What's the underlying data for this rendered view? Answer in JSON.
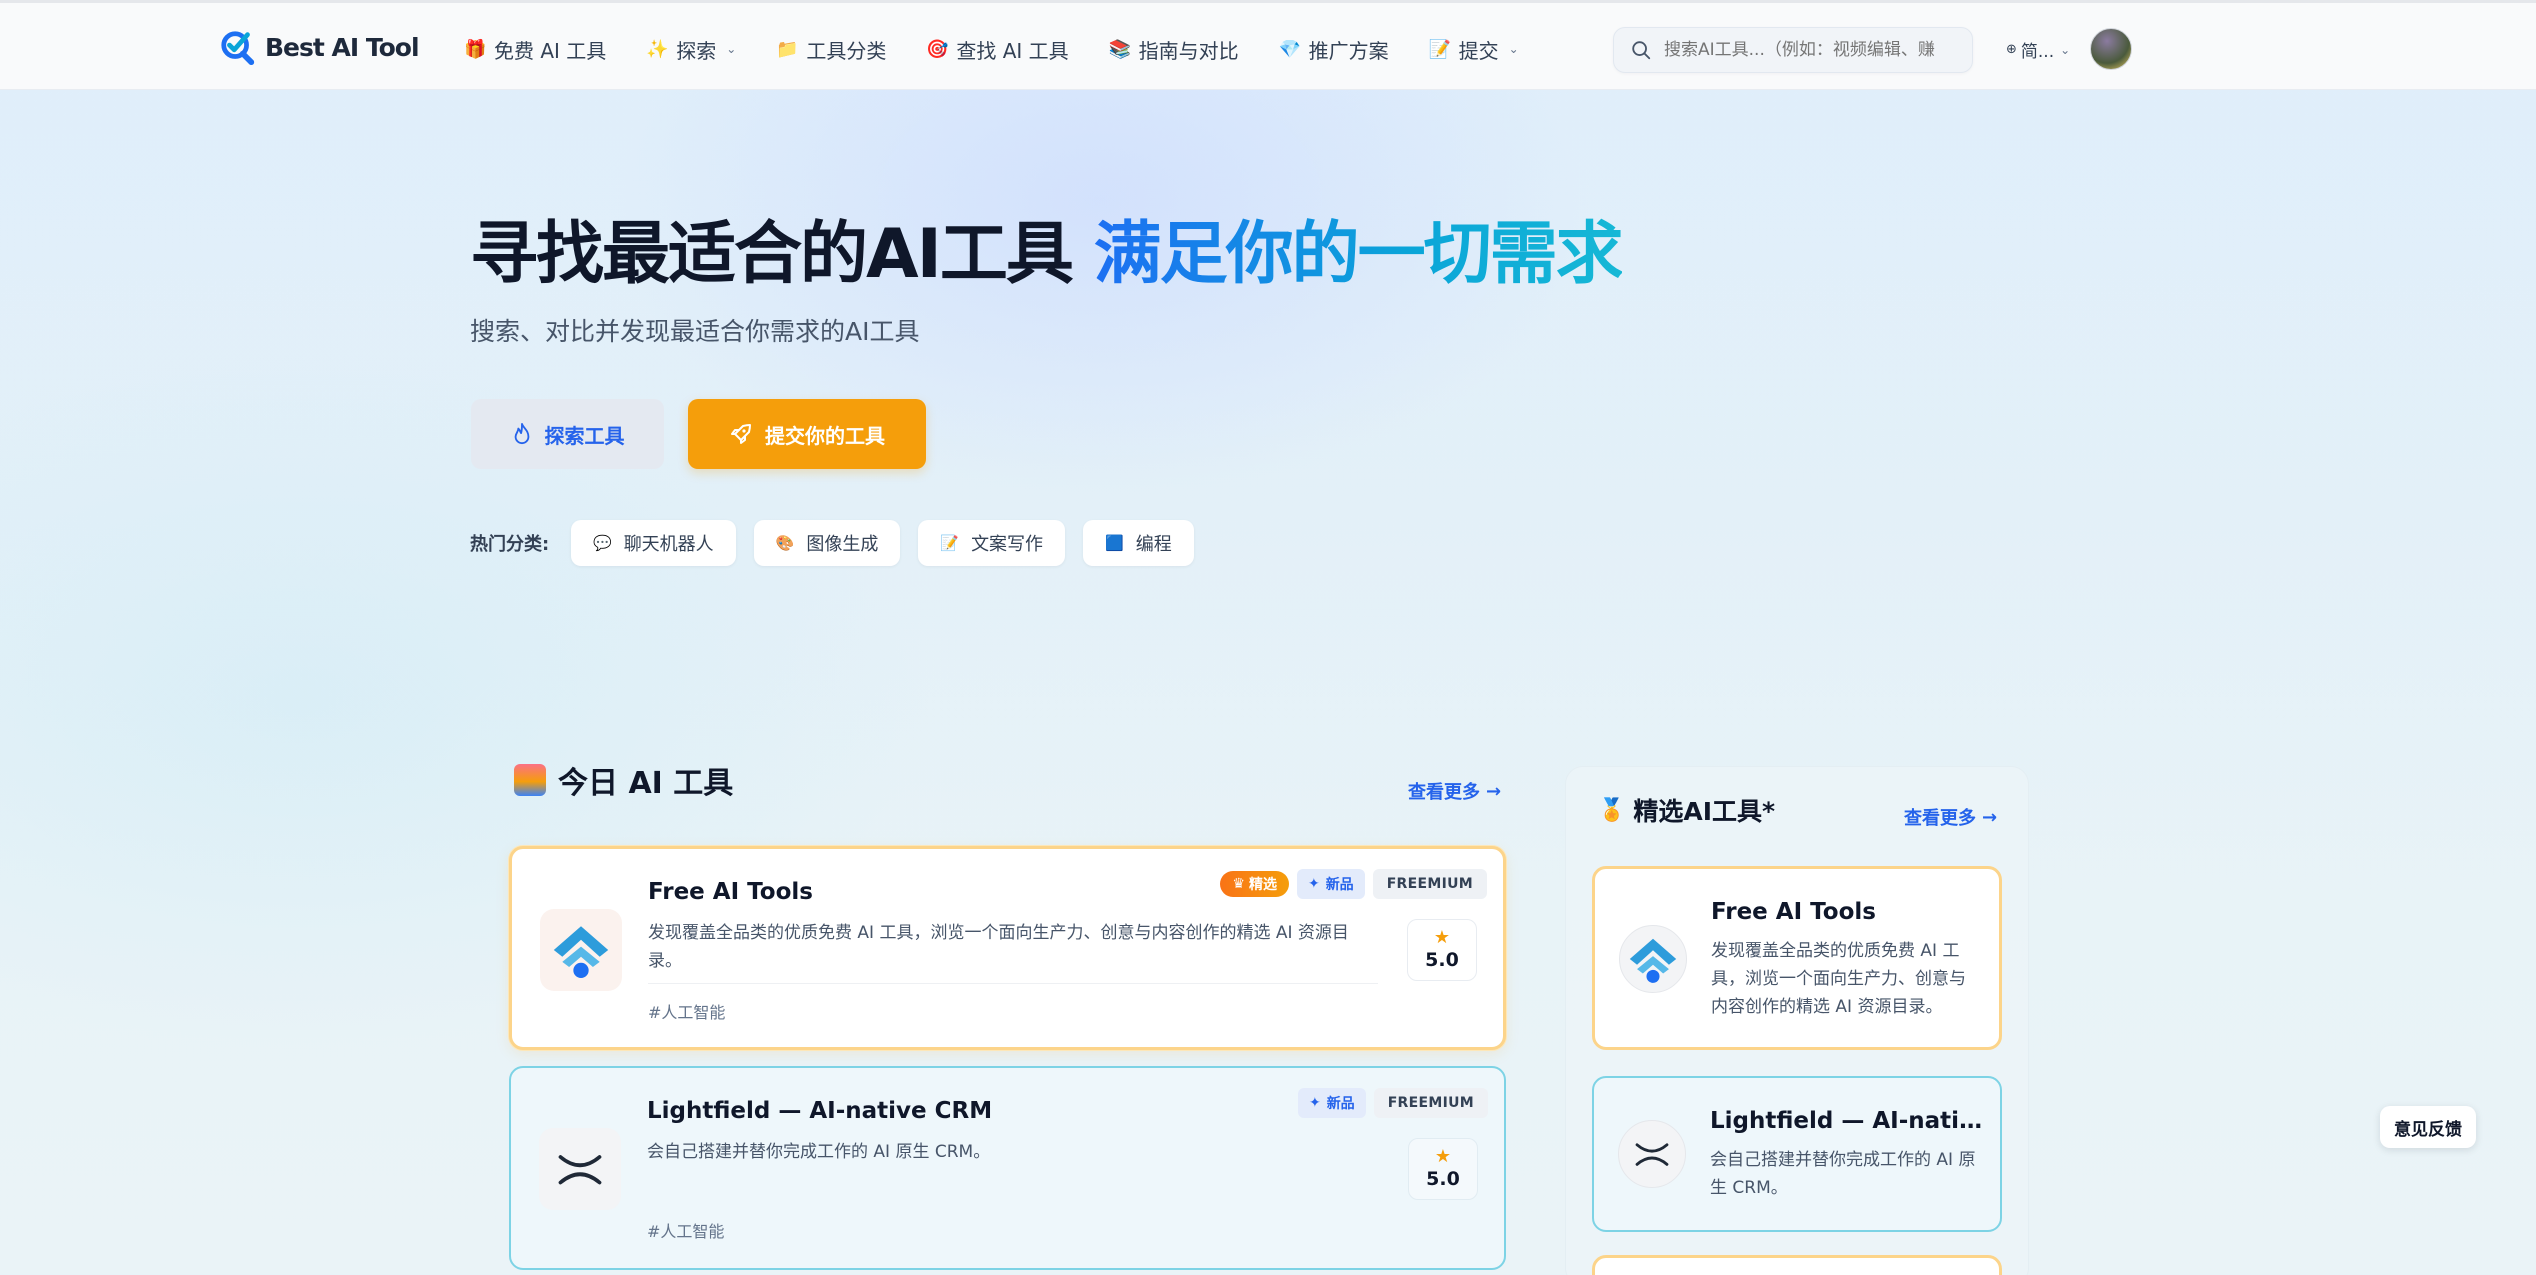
{
  "header": {
    "brand": "Best AI Tool",
    "nav": [
      {
        "icon": "gift-icon",
        "glyph": "🎁",
        "label": "免费 AI 工具",
        "dropdown": false
      },
      {
        "icon": "sparkle-icon",
        "glyph": "✨",
        "label": "探索",
        "dropdown": true
      },
      {
        "icon": "folder-icon",
        "glyph": "📁",
        "label": "工具分类",
        "dropdown": false
      },
      {
        "icon": "target-icon",
        "glyph": "🎯",
        "label": "查找 AI 工具",
        "dropdown": false
      },
      {
        "icon": "books-icon",
        "glyph": "📚",
        "label": "指南与对比",
        "dropdown": false
      },
      {
        "icon": "diamond-icon",
        "glyph": "💎",
        "label": "推广方案",
        "dropdown": false
      },
      {
        "icon": "memo-icon",
        "glyph": "📝",
        "label": "提交",
        "dropdown": true
      }
    ],
    "search_placeholder": "搜索AI工具...（例如：视频编辑、赚",
    "language": "简..."
  },
  "hero": {
    "title_dark": "寻找最适合的AI工具",
    "title_accent": "满足你的一切需求",
    "subtitle": "搜索、对比并发现最适合你需求的AI工具",
    "explore_button": "探索工具",
    "submit_button": "提交你的工具",
    "hot_label": "热门分类:",
    "hot_categories": [
      {
        "icon": "speech-bubble-icon",
        "glyph": "💬",
        "label": "聊天机器人"
      },
      {
        "icon": "palette-icon",
        "glyph": "🎨",
        "label": "图像生成"
      },
      {
        "icon": "writing-icon",
        "glyph": "📝",
        "label": "文案写作"
      },
      {
        "icon": "code-icon",
        "glyph": "🟦",
        "label": "编程"
      }
    ]
  },
  "today": {
    "title": "今日 AI 工具",
    "more": "查看更多",
    "tools": [
      {
        "name": "Free AI Tools",
        "description": "发现覆盖全品类的优质免费 AI 工具，浏览一个面向生产力、创意与内容创作的精选 AI 资源目录。",
        "tag": "#人工智能",
        "featured_badge": "精选",
        "new_badge": "新品",
        "pricing": "FREEMIUM",
        "rating": "5.0",
        "style": "gold"
      },
      {
        "name": "Lightfield — AI-native CRM",
        "description": "会自己搭建并替你完成工作的 AI 原生 CRM。",
        "tag": "#人工智能",
        "new_badge": "新品",
        "pricing": "FREEMIUM",
        "rating": "5.0",
        "style": "teal"
      }
    ]
  },
  "featured": {
    "title": "精选AI工具*",
    "more": "查看更多",
    "tools": [
      {
        "name": "Free AI Tools",
        "description": "发现覆盖全品类的优质免费 AI 工具，浏览一个面向生产力、创意与内容创作的精选 AI 资源目录。"
      },
      {
        "name": "Lightfield — AI-native CRM",
        "description": "会自己搭建并替你完成工作的 AI 原生 CRM。"
      }
    ]
  },
  "feedback": "意见反馈",
  "colors": {
    "accent_blue": "#2563eb",
    "accent_orange": "#f59e0b",
    "gold_border": "#fcd48a",
    "teal_border": "#7dd3e5"
  }
}
